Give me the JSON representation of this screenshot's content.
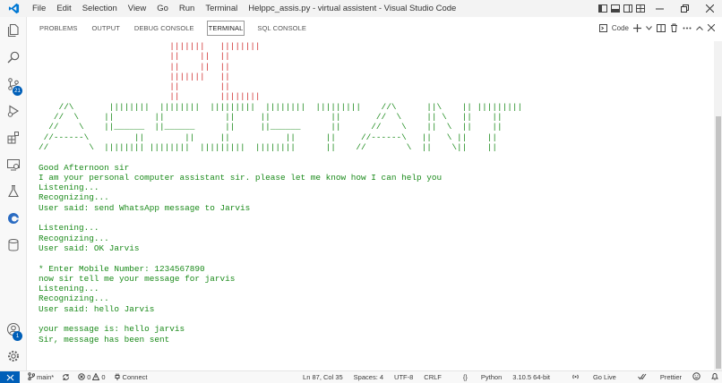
{
  "window": {
    "title": "pc_assis.py - virtual assistent - Visual Studio Code"
  },
  "menu": [
    "File",
    "Edit",
    "Selection",
    "View",
    "Go",
    "Run",
    "Terminal",
    "Help"
  ],
  "panel": {
    "tabs": [
      "PROBLEMS",
      "OUTPUT",
      "DEBUG CONSOLE",
      "TERMINAL",
      "SQL CONSOLE"
    ],
    "active_tab": "TERMINAL",
    "terminal_kind": "Code"
  },
  "activity": {
    "source_control_badge": "21",
    "accounts_badge": "1"
  },
  "terminal": {
    "banner_pc": [
      "                          |||||||   ||||||||",
      "                          ||    ||  ||",
      "                          ||    ||  ||",
      "                          |||||||   ||",
      "                          ||        ||",
      "                          ||        ||||||||"
    ],
    "banner_assistant": [
      "    //\\       ||||||||  ||||||||  |||||||||  ||||||||  |||||||||    //\\      ||\\    || |||||||||",
      "   //  \\     ||        ||            ||     ||            ||       //  \\     || \\   ||    ||",
      "  //    \\    ||______  ||______      ||     ||______      ||      //    \\    ||  \\  ||    ||",
      " //------\\         ||        ||     ||           ||      ||     //------\\   ||   \\ ||    ||",
      "//        \\  |||||||| ||||||||  |||||||||  ||||||||      ||    //        \\  ||    \\||    ||"
    ],
    "lines": [
      "Good Afternoon sir",
      "I am your personal computer assistant sir. please let me know how I can help you",
      "Listening...",
      "Recognizing...",
      "User said: send WhatsApp message to Jarvis",
      "",
      "Listening...",
      "Recognizing...",
      "User said: OK Jarvis",
      "",
      "* Enter Mobile Number: 1234567890",
      "now sir tell me your message for jarvis",
      "Listening...",
      "Recognizing...",
      "User said: hello Jarvis",
      "",
      "your message is: hello jarvis",
      "Sir, message has been sent"
    ]
  },
  "status": {
    "branch": "main*",
    "errors": "0",
    "warnings": "0",
    "connect": "Connect",
    "position": "Ln 87, Col 35",
    "spaces": "Spaces: 4",
    "encoding": "UTF-8",
    "eol": "CRLF",
    "language": "Python",
    "interpreter": "3.10.5 64-bit",
    "golive": "Go Live",
    "prettier": "Prettier"
  },
  "colors": {
    "accent": "#005fb8",
    "terminal_text": "#1a8a1a",
    "banner_red": "#d03030"
  }
}
